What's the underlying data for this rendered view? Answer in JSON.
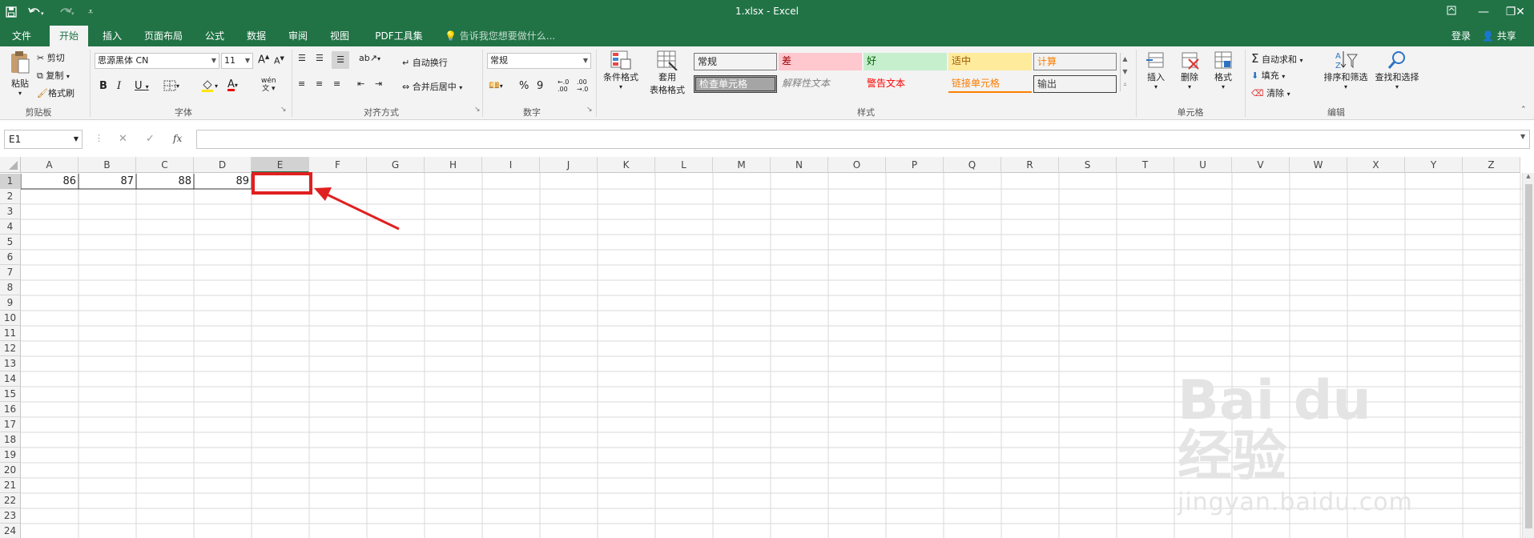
{
  "window": {
    "title": "1.xlsx - Excel",
    "login": "登录",
    "share": "共享"
  },
  "tabs": [
    {
      "label": "文件"
    },
    {
      "label": "开始"
    },
    {
      "label": "插入"
    },
    {
      "label": "页面布局"
    },
    {
      "label": "公式"
    },
    {
      "label": "数据"
    },
    {
      "label": "审阅"
    },
    {
      "label": "视图"
    },
    {
      "label": "PDF工具集"
    }
  ],
  "tell_me": "告诉我您想要做什么...",
  "ribbon": {
    "clipboard": {
      "paste": "粘贴",
      "cut": "剪切",
      "copy": "复制",
      "format_painter": "格式刷",
      "group": "剪贴板"
    },
    "font": {
      "name": "思源黑体 CN",
      "size": "11",
      "group": "字体",
      "bold": "B",
      "italic": "I",
      "underline": "U",
      "grow": "A",
      "shrink": "A",
      "font_color_letter": "A",
      "phonetic": "wén"
    },
    "alignment": {
      "wrap": "自动换行",
      "merge": "合并后居中",
      "group": "对齐方式"
    },
    "number": {
      "format": "常规",
      "percent": "%",
      "comma": "9",
      "group": "数字",
      "inc_decimal": "←.0\n.00",
      "dec_decimal": ".00\n→.0"
    },
    "styles": {
      "conditional": "条件格式",
      "table1": "套用",
      "table2": "表格格式",
      "cells": [
        {
          "label": "常规",
          "bg": "#ffffff",
          "color": "#000000"
        },
        {
          "label": "差",
          "bg": "#ffc7ce",
          "color": "#9c0006"
        },
        {
          "label": "好",
          "bg": "#c6efce",
          "color": "#006100"
        },
        {
          "label": "适中",
          "bg": "#ffeb9c",
          "color": "#9c5700"
        },
        {
          "label": "计算",
          "bg": "#f2f2f2",
          "color": "#fa7d00"
        },
        {
          "label": "检查单元格",
          "bg": "#a5a5a5",
          "color": "#ffffff"
        },
        {
          "label": "解释性文本",
          "bg": "#ffffff",
          "color": "#7f7f7f"
        },
        {
          "label": "警告文本",
          "bg": "#ffffff",
          "color": "#ff0000"
        },
        {
          "label": "链接单元格",
          "bg": "#ffffff",
          "color": "#fa7d00"
        },
        {
          "label": "输出",
          "bg": "#f2f2f2",
          "color": "#3f3f3f"
        }
      ],
      "group": "样式"
    },
    "cells": {
      "insert": "插入",
      "delete": "删除",
      "format": "格式",
      "group": "单元格"
    },
    "editing": {
      "autosum": "自动求和",
      "fill": "填充",
      "clear": "清除",
      "sort": "排序和筛选",
      "find": "查找和选择",
      "group": "编辑",
      "sigma": "Σ"
    }
  },
  "formula_bar": {
    "name_box": "E1",
    "fx": "fx",
    "cancel": "✕",
    "enter": "✓",
    "value": ""
  },
  "sheet": {
    "columns": [
      "A",
      "B",
      "C",
      "D",
      "E",
      "F",
      "G",
      "H",
      "I",
      "J",
      "K",
      "L",
      "M",
      "N",
      "O",
      "P",
      "Q",
      "R",
      "S",
      "T",
      "U",
      "V",
      "W",
      "X",
      "Y",
      "Z"
    ],
    "rows": [
      "1",
      "2",
      "3",
      "4",
      "5",
      "6",
      "7",
      "8",
      "9",
      "10",
      "11",
      "12",
      "13",
      "14",
      "15",
      "16",
      "17",
      "18",
      "19",
      "20",
      "21",
      "22",
      "23",
      "24"
    ],
    "values": {
      "A1": "86",
      "B1": "87",
      "C1": "88",
      "D1": "89"
    },
    "selected_cell": "E1"
  },
  "watermark": {
    "brand": "Bai du 经验",
    "url": "jingyan.baidu.com"
  },
  "colors": {
    "accent": "#217346",
    "annotation": "#e02020"
  }
}
